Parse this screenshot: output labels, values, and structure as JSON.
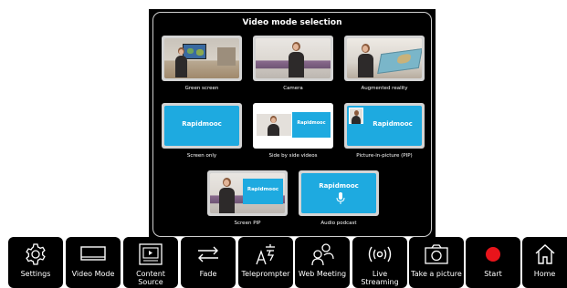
{
  "dialog": {
    "title": "Video mode selection",
    "modes": [
      {
        "label": "Green screen",
        "icon": "green-screen-scene"
      },
      {
        "label": "Camera",
        "icon": "camera-scene"
      },
      {
        "label": "Augmented reality",
        "icon": "augmented-reality-scene"
      },
      {
        "label": "Screen only",
        "icon": "screen-only-scene"
      },
      {
        "label": "Side by side videos",
        "icon": "side-by-side-scene"
      },
      {
        "label": "Picture-in-picture (PIP)",
        "icon": "pip-scene"
      },
      {
        "label": "Screen PIP",
        "icon": "screen-pip-scene"
      },
      {
        "label": "Audio podcast",
        "icon": "audio-podcast-scene"
      }
    ],
    "brand": "Rapidmooc"
  },
  "toolbar": {
    "items": [
      {
        "label": "Settings",
        "icon": "gear-icon"
      },
      {
        "label": "Video Mode",
        "icon": "monitor-icon"
      },
      {
        "label_line1": "Content",
        "label_line2": "Source",
        "icon": "content-source-icon"
      },
      {
        "label": "Fade",
        "icon": "swap-arrows-icon"
      },
      {
        "label": "Teleprompter",
        "icon": "teleprompter-icon"
      },
      {
        "label": "Web Meeting",
        "icon": "people-icon"
      },
      {
        "label_line1": "Live",
        "label_line2": "Streaming",
        "icon": "broadcast-icon"
      },
      {
        "label": "Take a picture",
        "icon": "camera-icon"
      },
      {
        "label": "Start",
        "icon": "record-icon"
      },
      {
        "label": "Home",
        "icon": "home-icon"
      }
    ],
    "record_color": "#e8141b"
  }
}
